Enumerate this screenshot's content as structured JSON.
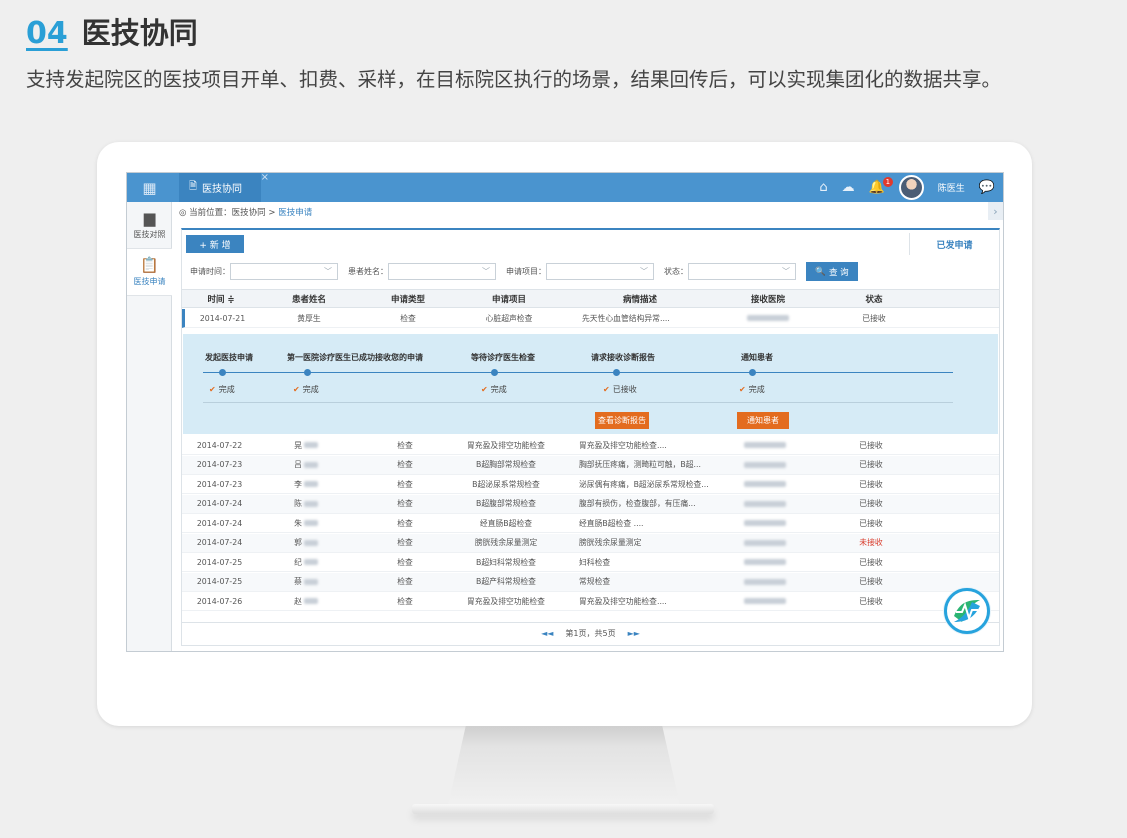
{
  "slide": {
    "number": "04",
    "title": "医技协同",
    "description": "支持发起院区的医技项目开单、扣费、采样，在目标院区执行的场景，结果回传后，可以实现集团化的数据共享。"
  },
  "app": {
    "tab_label": "医技协同",
    "user_name": "陈医生",
    "notification_count": "1",
    "sidebar": [
      {
        "label": "医技对照",
        "icon": "document-icon"
      },
      {
        "label": "医技申请",
        "icon": "clipboard-icon"
      }
    ],
    "breadcrumb": {
      "prefix": "当前位置：",
      "parent": "医技协同",
      "separator": ">",
      "current": "医技申请"
    },
    "new_button": "+ 新 增",
    "sent_tab": "已发申请",
    "filters": {
      "time_label": "申请时间：",
      "patient_label": "患者姓名：",
      "item_label": "申请项目：",
      "status_label": "状态：",
      "search_button": "查 询"
    },
    "columns": [
      "时间 ≑",
      "患者姓名",
      "申请类型",
      "申请项目",
      "病情描述",
      "接收医院",
      "状态"
    ],
    "first_row": {
      "date": "2014-07-21",
      "patient": "黄厚生",
      "type": "检查",
      "item": "心脏超声检查",
      "desc": "先天性心血管结构异常....",
      "status": "已接收"
    },
    "workflow": {
      "steps": [
        {
          "title": "发起医技申请",
          "state": "完成"
        },
        {
          "title": "第一医院诊疗医生已成功接收您的申请",
          "state": "完成"
        },
        {
          "title": "等待诊疗医生检查",
          "state": "完成"
        },
        {
          "title": "请求接收诊断报告",
          "state": "已接收"
        },
        {
          "title": "通知患者",
          "state": "完成"
        }
      ],
      "report_button": "查看诊断报告",
      "notify_button": "通知患者"
    },
    "rows": [
      {
        "date": "2014-07-22",
        "patient": "晃",
        "type": "检查",
        "item": "胃充盈及排空功能检查",
        "desc": "胃充盈及排空功能检查....",
        "status": "已接收"
      },
      {
        "date": "2014-07-23",
        "patient": "吕",
        "type": "检查",
        "item": "B超胸部常规检查",
        "desc": "胸部抚压疼痛，测畸粒可触，B超...",
        "status": "已接收"
      },
      {
        "date": "2014-07-23",
        "patient": "李",
        "type": "检查",
        "item": "B超泌尿系常规检查",
        "desc": "泌尿偶有疼痛，B超泌尿系常规检查...",
        "status": "已接收"
      },
      {
        "date": "2014-07-24",
        "patient": "陈",
        "type": "检查",
        "item": "B超腹部常规检查",
        "desc": "腹部有损伤，检查腹部，有压痛...",
        "status": "已接收"
      },
      {
        "date": "2014-07-24",
        "patient": "朱",
        "type": "检查",
        "item": "经直肠B超检查",
        "desc": "经直肠B超检查        ....",
        "status": "已接收"
      },
      {
        "date": "2014-07-24",
        "patient": "郭",
        "type": "检查",
        "item": "膀胱残余尿量测定",
        "desc": "膀胱残余尿量测定",
        "status": "未接收"
      },
      {
        "date": "2014-07-25",
        "patient": "纪",
        "type": "检查",
        "item": "B超妇科常规检查",
        "desc": "妇科检查",
        "status": "已接收"
      },
      {
        "date": "2014-07-25",
        "patient": "蔡",
        "type": "检查",
        "item": "B超产科常规检查",
        "desc": "常规检查",
        "status": "已接收"
      },
      {
        "date": "2014-07-26",
        "patient": "赵",
        "type": "检查",
        "item": "胃充盈及排空功能检查",
        "desc": "胃充盈及排空功能检查....",
        "status": "已接收"
      }
    ],
    "pager": {
      "prev": "◄◄",
      "text": "第1页，共5页",
      "next": "►►"
    },
    "colors": {
      "primary": "#3b84c0",
      "topbar": "#4a94cf",
      "accent": "#e36c1f",
      "pending": "#d83a2a",
      "workflow_bg": "#d6ebf6"
    }
  }
}
